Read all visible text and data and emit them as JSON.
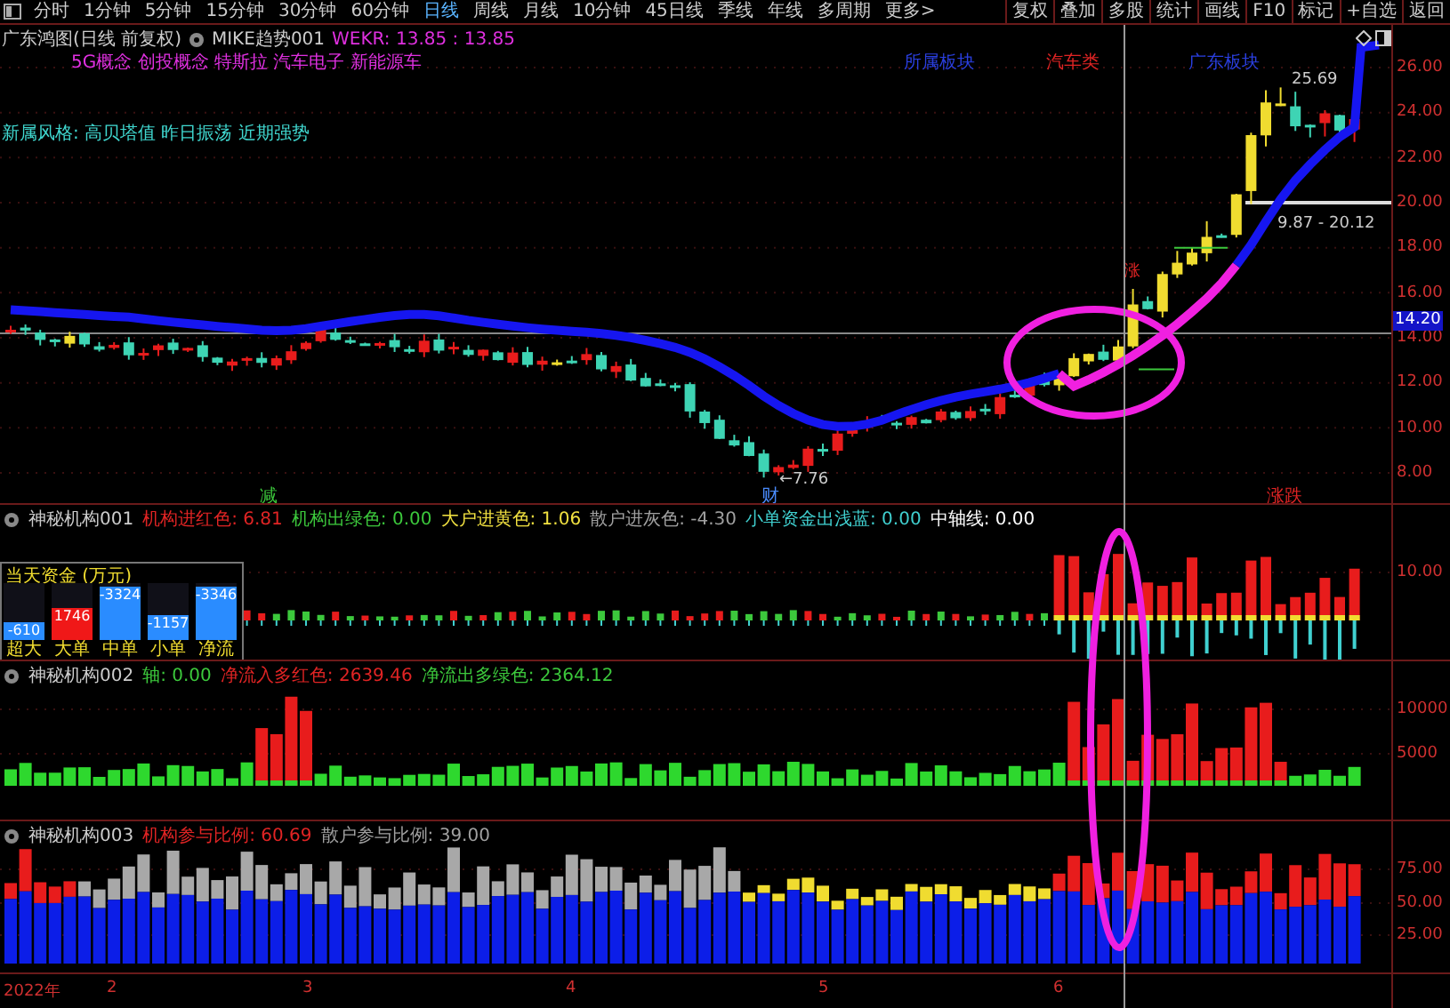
{
  "toolbar": {
    "tabs": [
      {
        "label": "分时",
        "selected": false
      },
      {
        "label": "1分钟",
        "selected": false
      },
      {
        "label": "5分钟",
        "selected": false
      },
      {
        "label": "15分钟",
        "selected": false
      },
      {
        "label": "30分钟",
        "selected": false
      },
      {
        "label": "60分钟",
        "selected": false
      },
      {
        "label": "日线",
        "selected": true
      },
      {
        "label": "周线",
        "selected": false
      },
      {
        "label": "月线",
        "selected": false
      },
      {
        "label": "10分钟",
        "selected": false
      },
      {
        "label": "45日线",
        "selected": false
      },
      {
        "label": "季线",
        "selected": false
      },
      {
        "label": "年线",
        "selected": false
      },
      {
        "label": "多周期",
        "selected": false
      },
      {
        "label": "更多>",
        "selected": false
      }
    ],
    "buttons": [
      "复权",
      "叠加",
      "多股",
      "统计",
      "画线",
      "F10",
      "标记",
      "+自选",
      "返回"
    ]
  },
  "main_chart": {
    "title": "广东鸿图(日线 前复权)",
    "indicator": "MIKE趋势001",
    "indicator_value": "WEKR: 13.85 : 13.85",
    "concepts": "5G概念 创投概念 特斯拉 汽车电子 新能源车",
    "sector_labels": [
      {
        "text": "所属板块",
        "color": "#2a3fe0"
      },
      {
        "text": "汽车类",
        "color": "#e02424"
      },
      {
        "text": "广东板块",
        "color": "#2a3fe0"
      }
    ],
    "style_line": "新属风格: 高贝塔值 昨日振荡 近期强势",
    "y_ticks": [
      "26.00",
      "24.00",
      "22.00",
      "20.00",
      "18.00",
      "16.00",
      "14.00",
      "12.00",
      "10.00",
      "8.00"
    ],
    "price_tag": "14.20",
    "high_label": "25.69",
    "range_label": "9.87 - 20.12",
    "low_label": "←7.76",
    "small_mark": "涨",
    "markers": [
      {
        "text": "减",
        "color": "#3cc83c"
      },
      {
        "text": "财",
        "color": "#4a8cff"
      },
      {
        "text": "涨跌",
        "color": "#e02424"
      }
    ]
  },
  "panels": [
    {
      "kind": "flow",
      "name": "神秘机构001",
      "readings": [
        {
          "text": "机构进红色: 6.81",
          "color": "#e02424"
        },
        {
          "text": "机构出绿色: 0.00",
          "color": "#3cc83c"
        },
        {
          "text": "大户进黄色: 1.06",
          "color": "#f0e040"
        },
        {
          "text": "散户进灰色: -4.30",
          "color": "#a0a0a0"
        },
        {
          "text": "小单资金出浅蓝: 0.00",
          "color": "#40d0d0"
        },
        {
          "text": "中轴线: 0.00",
          "color": "#ffffff"
        }
      ],
      "y_ticks": [
        "10.00"
      ],
      "fund_box": {
        "title": "当天资金 (万元)",
        "items": [
          {
            "label": "超大",
            "value": "-610",
            "level": 0.3,
            "color": "#2a8cff"
          },
          {
            "label": "大单",
            "value": "1746",
            "level": 0.55,
            "color": "#f01818"
          },
          {
            "label": "中单",
            "value": "-3324",
            "level": 0.95,
            "color": "#2a8cff"
          },
          {
            "label": "小单",
            "value": "-1157",
            "level": 0.45,
            "color": "#2a8cff"
          },
          {
            "label": "净流",
            "value": "-3346",
            "level": 0.95,
            "color": "#2a8cff"
          }
        ]
      }
    },
    {
      "kind": "net",
      "name": "神秘机构002",
      "readings": [
        {
          "text": "轴: 0.00",
          "color": "#3cc83c"
        },
        {
          "text": "净流入多红色: 2639.46",
          "color": "#e02424"
        },
        {
          "text": "净流出多绿色: 2364.12",
          "color": "#3cc83c"
        }
      ],
      "y_ticks": [
        "10000",
        "5000"
      ]
    },
    {
      "kind": "ratio",
      "name": "神秘机构003",
      "readings": [
        {
          "text": "机构参与比例: 60.69",
          "color": "#e02424"
        },
        {
          "text": "散户参与比例: 39.00",
          "color": "#a0a0a0"
        }
      ],
      "y_ticks": [
        "75.00",
        "50.00",
        "25.00"
      ]
    }
  ],
  "date_axis": [
    "2022年",
    "2",
    "3",
    "4",
    "5",
    "6"
  ]
}
